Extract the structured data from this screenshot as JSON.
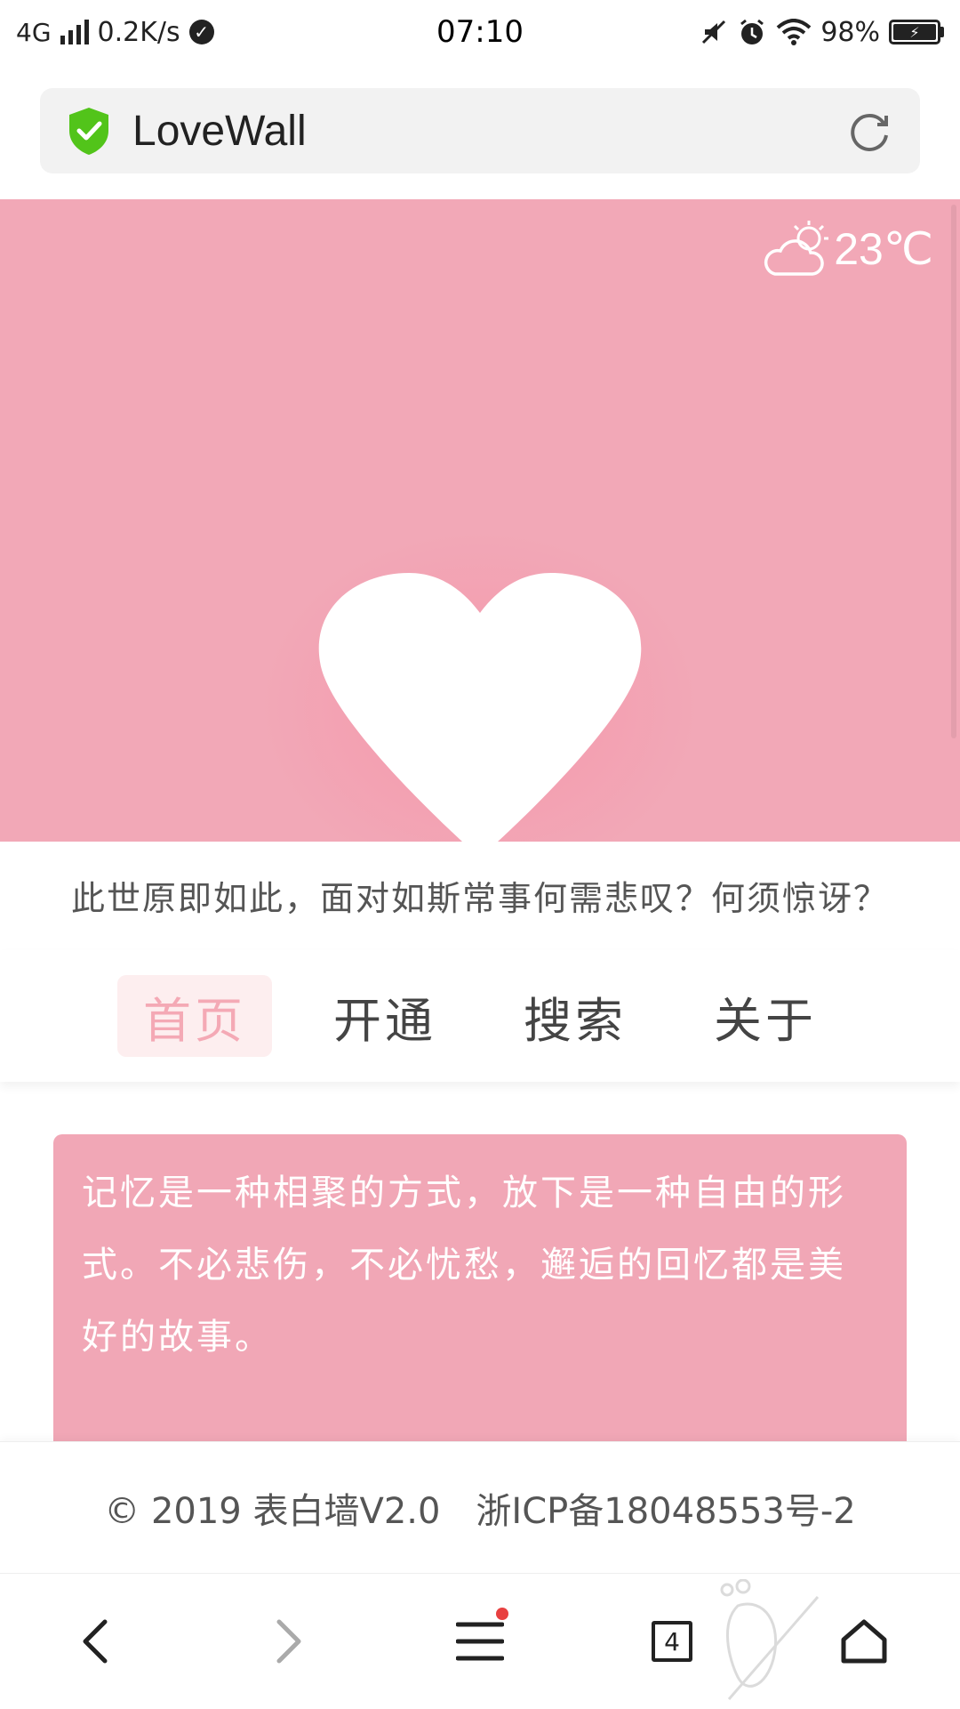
{
  "status_bar": {
    "network": "4G",
    "speed": "0.2K/s",
    "time": "07:10",
    "battery": "98%"
  },
  "url_bar": {
    "title": "LoveWall",
    "shield_color": "#52c41a"
  },
  "hero": {
    "temperature": "23℃",
    "background": "#f2a8b7"
  },
  "quote": "此世原即如此，面对如斯常事何需悲叹？何须惊讶？",
  "nav": {
    "tabs": [
      {
        "label": "首页",
        "active": true
      },
      {
        "label": "开通",
        "active": false
      },
      {
        "label": "搜索",
        "active": false
      },
      {
        "label": "关于",
        "active": false
      }
    ]
  },
  "card": {
    "text": "记忆是一种相聚的方式，放下是一种自由的形式。不必悲伤，不必忧愁，邂逅的回忆都是美好的故事。"
  },
  "footer": {
    "text": "© 2019 表白墙V2.0　浙ICP备18048553号-2"
  },
  "browser_bar": {
    "tab_count": "4"
  }
}
